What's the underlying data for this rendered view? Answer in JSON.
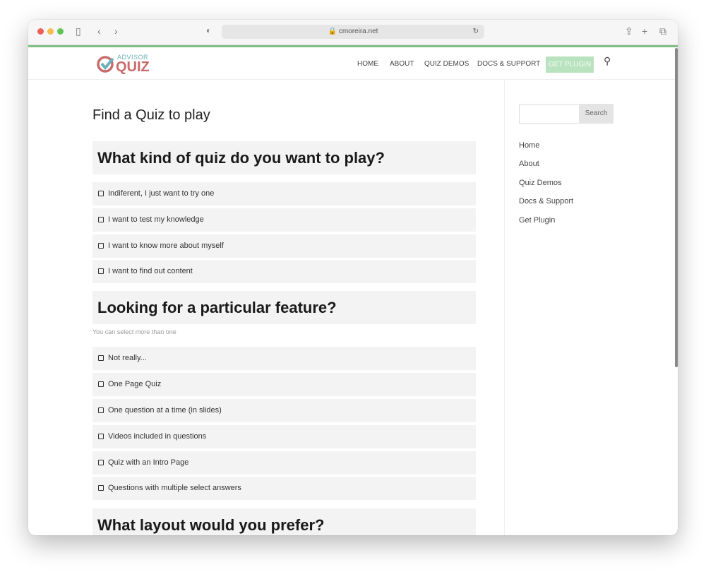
{
  "browser": {
    "url": "cmoreira.net",
    "colors": {
      "close": "#ee5f57",
      "min": "#f5bd4f",
      "max": "#61c454"
    }
  },
  "header": {
    "logo_top": "ADVISOR",
    "logo_bottom": "QUIZ",
    "nav": [
      "HOME",
      "ABOUT",
      "QUIZ DEMOS",
      "DOCS & SUPPORT"
    ],
    "cta": "GET PLUGIN",
    "accent": "#b9e2bf"
  },
  "main": {
    "title": "Find a Quiz to play",
    "q1": {
      "heading": "What kind of quiz do you want to play?",
      "options": [
        "Indiferent, I just want to try one",
        "I want to test my knowledge",
        "I want to know more about myself",
        "I want to find out content"
      ]
    },
    "q2": {
      "heading": "Looking for a particular feature?",
      "help": "You can select more than one",
      "options": [
        "Not really...",
        "One Page Quiz",
        "One question at a time (in slides)",
        "Videos included in questions",
        "Quiz with an Intro Page",
        "Questions with multiple select answers"
      ]
    },
    "q3": {
      "heading": "What layout would you prefer?"
    }
  },
  "sidebar": {
    "search_button": "Search",
    "links": [
      "Home",
      "About",
      "Quiz Demos",
      "Docs & Support",
      "Get Plugin"
    ]
  }
}
